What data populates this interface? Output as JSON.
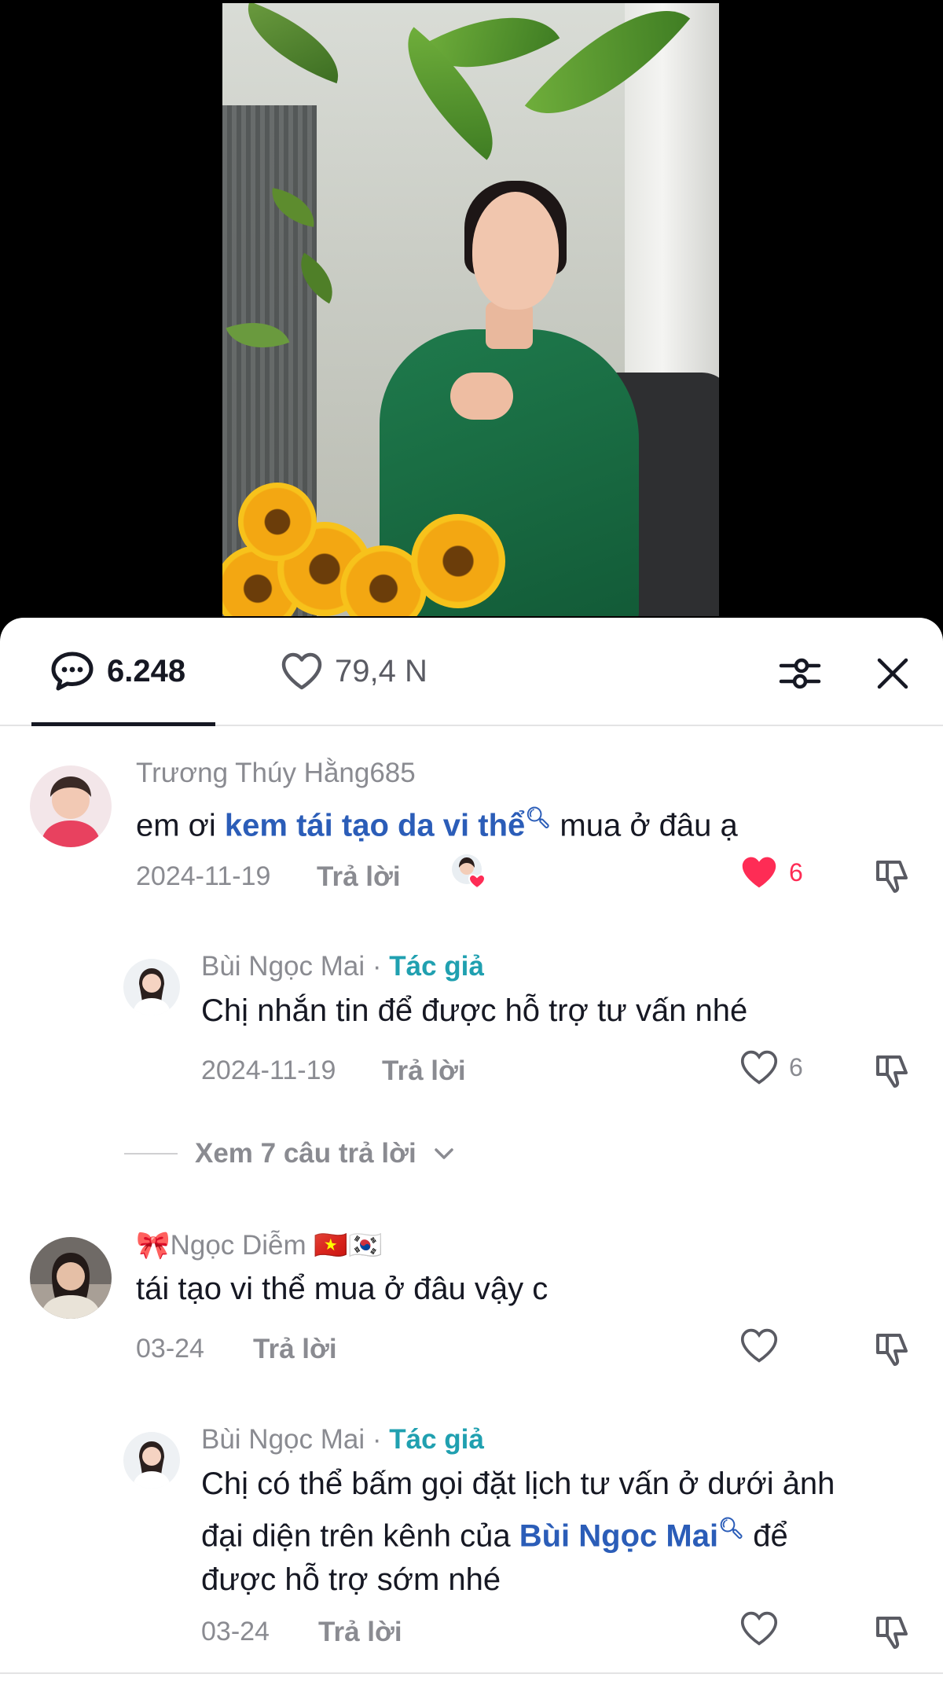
{
  "header": {
    "comment_count": "6.248",
    "like_count": "79,4 N"
  },
  "comments": [
    {
      "username": "Trương Thúy Hằng685",
      "text_before": "em ơi ",
      "link": "kem tái tạo da vi thể",
      "text_after": " mua ở đâu ạ",
      "date": "2024-11-19",
      "reply_label": "Trả lời",
      "likes": "6",
      "liked": true,
      "creator_liked": true
    },
    {
      "username": "Bùi Ngọc Mai",
      "separator": " · ",
      "author_label": "Tác giả",
      "text": "Chị nhắn tin để được hỗ trợ tư vấn nhé",
      "date": "2024-11-19",
      "reply_label": "Trả lời",
      "likes": "6",
      "liked": false
    },
    {
      "username": "🎀Ngọc Diễm 🇻🇳🇰🇷",
      "text": "tái tạo vi thể mua ở đâu vậy c",
      "date": "03-24",
      "reply_label": "Trả lời",
      "liked": false
    },
    {
      "username": "Bùi Ngọc Mai",
      "separator": " · ",
      "author_label": "Tác giả",
      "text_line1": "Chị có thể bấm gọi đặt lịch tư vấn ở dưới ảnh",
      "text_line2_before": "đại diện trên kênh của ",
      "link": "Bùi Ngọc Mai",
      "text_line2_after": " để",
      "text_line3": "được hỗ trợ sớm nhé",
      "date": "03-24",
      "reply_label": "Trả lời",
      "liked": false
    }
  ],
  "view_replies": "Xem 7 câu trả lời",
  "colors": {
    "like_active": "#fe2c55",
    "author_tag": "#20a0b0",
    "link": "#2b5db8",
    "muted": "#8a8b91"
  },
  "icons": [
    "comment-bubble-icon",
    "heart-outline-icon",
    "filter-icon",
    "close-icon",
    "heart-filled-icon",
    "dislike-icon",
    "search-icon",
    "chevron-down-icon"
  ]
}
